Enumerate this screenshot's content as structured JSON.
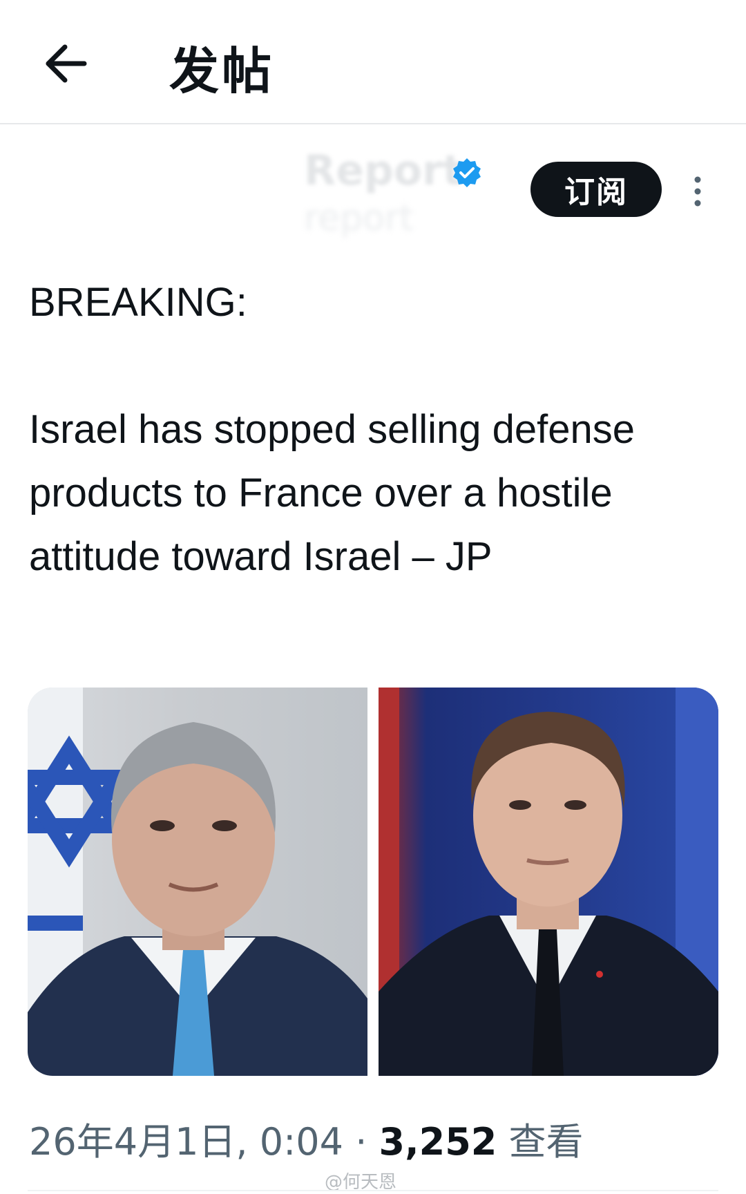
{
  "header": {
    "back_icon": "arrow-left-icon",
    "title": "发帖"
  },
  "author": {
    "name": "Report",
    "handle": "report",
    "verified_icon": "verified-badge-icon",
    "verified_color": "#1d9bf0"
  },
  "actions": {
    "subscribe_label": "订阅",
    "more_icon": "more-vertical-icon"
  },
  "tweet": {
    "text": "BREAKING:\n\nIsrael has stopped selling defense products to France over a hostile attitude toward Israel – JP"
  },
  "media": {
    "left_photo": "portrait-photo-israeli-leader",
    "right_photo": "portrait-photo-french-leader"
  },
  "meta": {
    "timestamp": "26年4月1日, 0:04",
    "separator": "·",
    "views_count": "3,252",
    "views_label": "查看"
  },
  "watermark": "@何天恩"
}
